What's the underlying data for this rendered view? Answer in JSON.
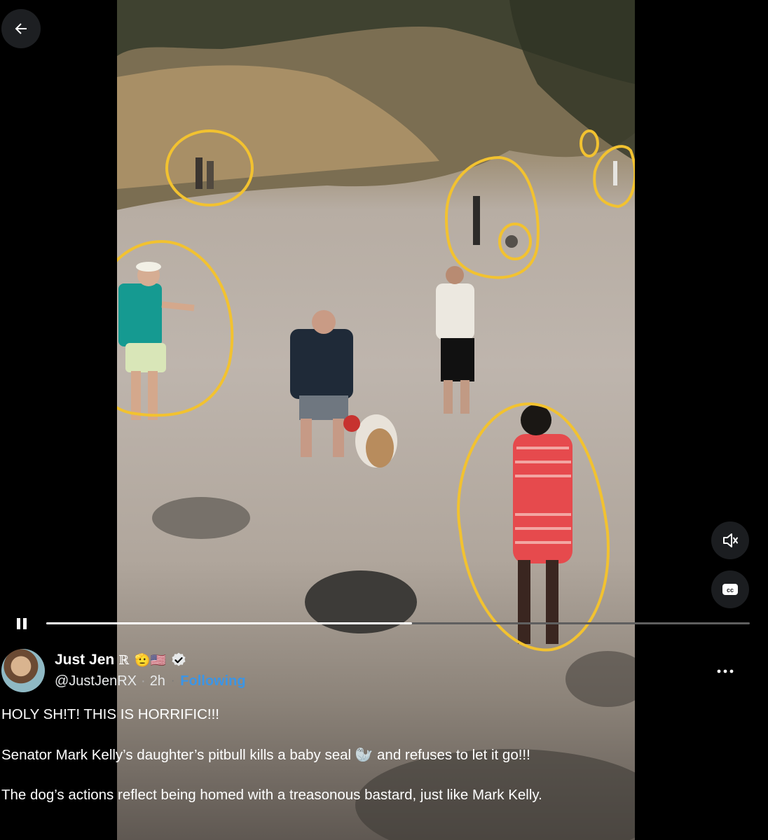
{
  "navigation": {
    "back_icon": "arrow-left-icon"
  },
  "video": {
    "progress_fraction": 0.52,
    "controls": {
      "pause_icon": "pause-icon",
      "volume_icon": "volume-muted-icon",
      "captions_icon": "closed-captions-icon",
      "captions_label": "cc"
    }
  },
  "author": {
    "name": "Just Jen",
    "name_suffix": "ℝ",
    "name_emoji": "🫡🇺🇸",
    "verified_icon": "verified-badge-icon",
    "handle": "@JustJenRX",
    "separator": "·",
    "time": "2h",
    "follow_status": "Following"
  },
  "more_icon": "more-options-icon",
  "post": {
    "line1": "HOLY SH!T! THIS IS HORRIFIC!!!",
    "line2": "Senator Mark Kelly’s daughter’s pitbull kills a baby seal 🦭 and refuses to let it go!!!",
    "line3": "The dog’s actions reflect being homed with a treasonous bastard, just like Mark Kelly."
  },
  "colors": {
    "background": "#000000",
    "accent_link": "#3b95e6",
    "annotation_circle": "#f2c230",
    "progress_fill": "#ffffff"
  }
}
